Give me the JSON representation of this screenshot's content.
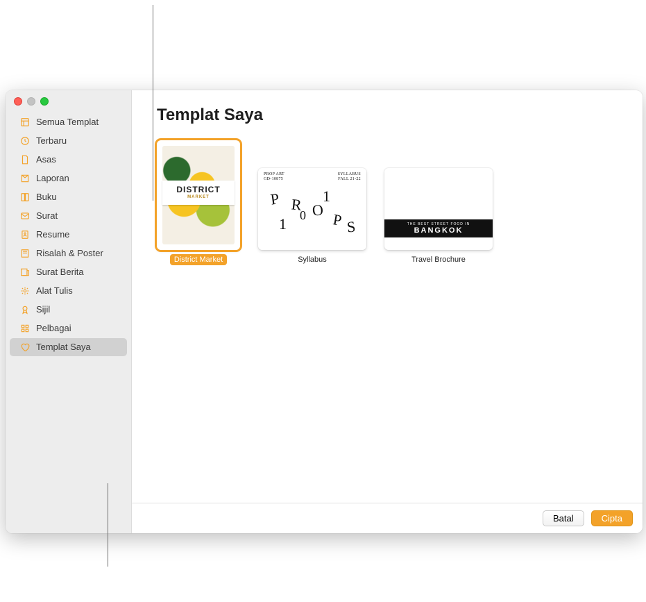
{
  "sidebar": {
    "items": [
      {
        "icon": "template-icon",
        "label": "Semua Templat"
      },
      {
        "icon": "clock-icon",
        "label": "Terbaru"
      },
      {
        "icon": "doc-icon",
        "label": "Asas"
      },
      {
        "icon": "report-icon",
        "label": "Laporan"
      },
      {
        "icon": "book-icon",
        "label": "Buku"
      },
      {
        "icon": "envelope-icon",
        "label": "Surat"
      },
      {
        "icon": "resume-icon",
        "label": "Resume"
      },
      {
        "icon": "poster-icon",
        "label": "Risalah & Poster"
      },
      {
        "icon": "news-icon",
        "label": "Surat Berita"
      },
      {
        "icon": "stationery-icon",
        "label": "Alat Tulis"
      },
      {
        "icon": "cert-icon",
        "label": "Sijil"
      },
      {
        "icon": "misc-icon",
        "label": "Pelbagai"
      },
      {
        "icon": "heart-icon",
        "label": "Templat Saya",
        "selected": true
      }
    ]
  },
  "main": {
    "title": "Templat Saya",
    "templates": [
      {
        "name": "District Market",
        "selected": true,
        "thumb": {
          "title": "DISTRICT",
          "subtitle": "MARKET",
          "tagline": ""
        }
      },
      {
        "name": "Syllabus",
        "thumb": {
          "top_left_line1": "PROP ART",
          "top_left_line2": "GD-10875",
          "top_right_line1": "SYLLABUS",
          "top_right_line2": "FALL 21-22",
          "letters": "PROPS",
          "digits": "110"
        }
      },
      {
        "name": "Travel Brochure",
        "thumb": {
          "strip_small": "THE BEST STREET FOOD IN",
          "strip_big": "BANGKOK"
        }
      }
    ]
  },
  "footer": {
    "cancel": "Batal",
    "create": "Cipta"
  }
}
